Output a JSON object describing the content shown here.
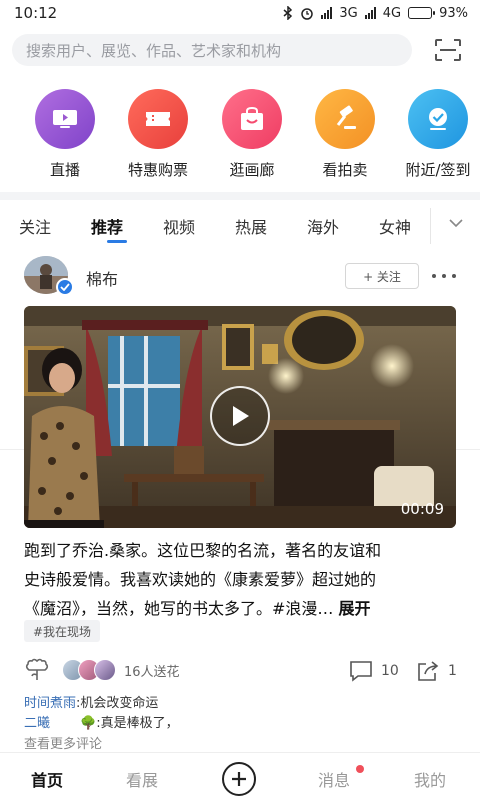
{
  "status_bar": {
    "time": "10:12",
    "network_a": "3G",
    "network_b": "4G",
    "battery": "93%",
    "battery_level": 0.93
  },
  "search": {
    "placeholder": "搜索用户、展览、作品、艺术家和机构"
  },
  "shortcuts": [
    {
      "label": "直播",
      "color": "#9b59d0",
      "icon": "tv-icon"
    },
    {
      "label": "特惠购票",
      "color": "#f0524a",
      "icon": "ticket-icon"
    },
    {
      "label": "逛画廊",
      "color": "#f54a6e",
      "icon": "gallery-bag-icon"
    },
    {
      "label": "看拍卖",
      "color": "#f6a030",
      "icon": "gavel-icon"
    },
    {
      "label": "附近/签到",
      "color": "#2aa6e8",
      "icon": "checkin-icon"
    }
  ],
  "tabs": [
    "关注",
    "推荐",
    "视频",
    "热展",
    "海外",
    "女神"
  ],
  "active_tab": "推荐",
  "post": {
    "author": "棉布",
    "follow_label": "+ 关注",
    "video_duration": "00:09",
    "text_lines": [
      "跑到了乔治.桑家。这位巴黎的名流，著名的友谊和",
      "史诗般爱情。我喜欢读她的《康素爱萝》超过她的",
      "《魔沼》，当然，她写的书太多了。#浪漫… "
    ],
    "expand_label": "展开",
    "hashtag": "#我在现场",
    "likes_text": "16人送花",
    "comments_count": "10",
    "shares_count": "1",
    "comments": [
      {
        "name": "时间煮雨",
        "sep": ":",
        "text": "机会改变命运"
      },
      {
        "name": "二曦",
        "sep": "",
        "text": ":真是棒极了，",
        "emoji": "🌳"
      }
    ],
    "see_more": "查看更多评论"
  },
  "bottom_nav": [
    "首页",
    "看展",
    "消息",
    "我的"
  ],
  "active_nav": "首页",
  "colors": {
    "accent": "#2a7be4",
    "badge": "#f0505a"
  }
}
